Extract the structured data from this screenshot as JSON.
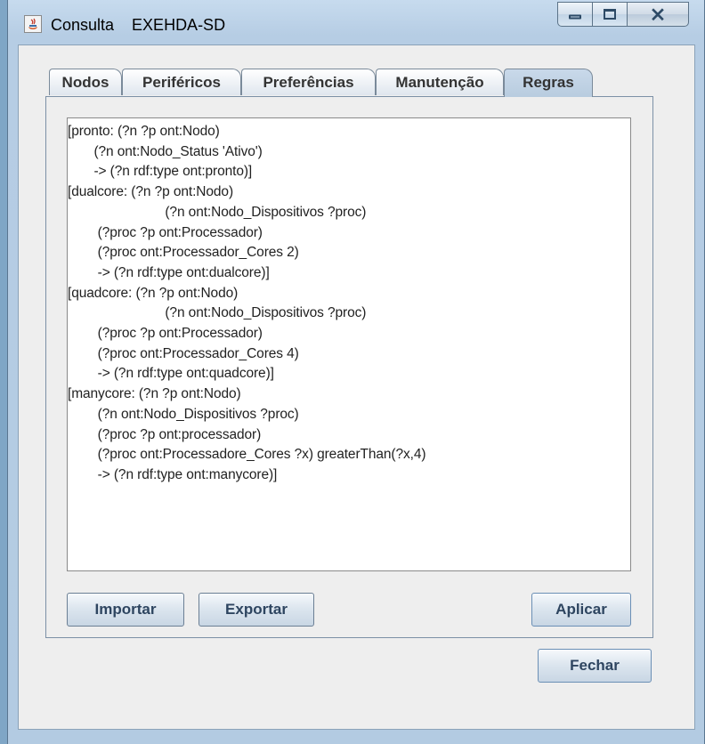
{
  "window": {
    "title": "Consulta    EXEHDA-SD",
    "controls": {
      "minimize_icon": "minimize-icon",
      "maximize_icon": "maximize-icon",
      "close_glyph": "⨯"
    }
  },
  "tabs": [
    {
      "label": "Nodos",
      "active": false
    },
    {
      "label": "Periféricos",
      "active": false
    },
    {
      "label": "Preferências",
      "active": false
    },
    {
      "label": "Manutenção",
      "active": false
    },
    {
      "label": "Regras",
      "active": true
    }
  ],
  "rules_editor": {
    "lines": [
      "[pronto: (?n ?p ont:Nodo)",
      "       (?n ont:Nodo_Status 'Ativo')",
      "       -> (?n rdf:type ont:pronto)]",
      "[dualcore: (?n ?p ont:Nodo)",
      "                          (?n ont:Nodo_Dispositivos ?proc)",
      "        (?proc ?p ont:Processador)",
      "        (?proc ont:Processador_Cores 2)",
      "        -> (?n rdf:type ont:dualcore)]",
      "[quadcore: (?n ?p ont:Nodo)",
      "                          (?n ont:Nodo_Dispositivos ?proc)",
      "        (?proc ?p ont:Processador)",
      "        (?proc ont:Processador_Cores 4)",
      "        -> (?n rdf:type ont:quadcore)]",
      "[manycore: (?n ?p ont:Nodo)",
      "        (?n ont:Nodo_Dispositivos ?proc)",
      "        (?proc ?p ont:processador)",
      "        (?proc ont:Processadore_Cores ?x) greaterThan(?x,4)",
      "        -> (?n rdf:type ont:manycore)]"
    ]
  },
  "buttons": {
    "import": "Importar",
    "export": "Exportar",
    "apply": "Aplicar",
    "close": "Fechar"
  }
}
